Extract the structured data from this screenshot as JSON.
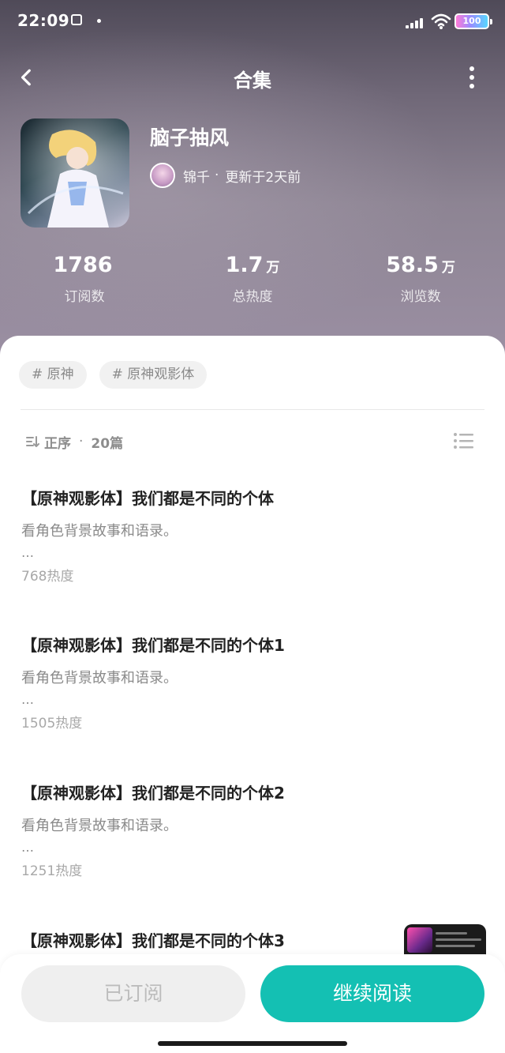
{
  "status_bar": {
    "time": "22:09",
    "battery": "100"
  },
  "nav": {
    "title": "合集"
  },
  "collection": {
    "title": "脑子抽风",
    "author": "锦千",
    "separator": "·",
    "updated": "更新于2天前"
  },
  "stats": [
    {
      "value": "1786",
      "unit": "",
      "label": "订阅数"
    },
    {
      "value": "1.7",
      "unit": "万",
      "label": "总热度"
    },
    {
      "value": "58.5",
      "unit": "万",
      "label": "浏览数"
    }
  ],
  "tags": [
    "# 原神",
    "# 原神观影体"
  ],
  "sort": {
    "order": "正序",
    "separator": "·",
    "count": "20篇"
  },
  "chapters": [
    {
      "title": "【原神观影体】我们都是不同的个体",
      "desc": "看角色背景故事和语录。",
      "ellipsis": "…",
      "heat": "768热度"
    },
    {
      "title": "【原神观影体】我们都是不同的个体1",
      "desc": "看角色背景故事和语录。",
      "ellipsis": "…",
      "heat": "1505热度"
    },
    {
      "title": "【原神观影体】我们都是不同的个体2",
      "desc": "看角色背景故事和语录。",
      "ellipsis": "…",
      "heat": "1251热度"
    },
    {
      "title": "【原神观影体】我们都是不同的个体3"
    }
  ],
  "actions": {
    "subscribed": "已订阅",
    "continue": "继续阅读"
  },
  "colors": {
    "accent": "#14c0b3",
    "hero_bg": "#8d8493"
  },
  "icons": [
    "back-arrow-icon",
    "more-vertical-icon",
    "sort-icon",
    "list-icon",
    "signal-icon",
    "wifi-icon",
    "battery-icon"
  ]
}
